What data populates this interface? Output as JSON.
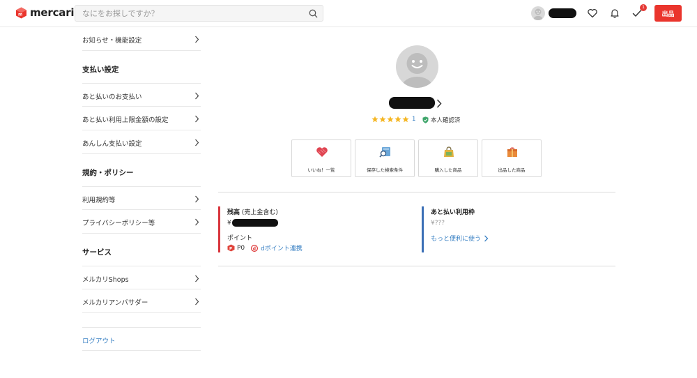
{
  "header": {
    "brand": "mercari",
    "search_placeholder": "なにをお探しですか？",
    "notification_badge": "1",
    "sell_label": "出品"
  },
  "sidebar": {
    "top_item": "お知らせ・機能設定",
    "sections": [
      {
        "title": "支払い設定",
        "items": [
          "あと払いのお支払い",
          "あと払い利用上限金額の設定",
          "あんしん支払い設定"
        ]
      },
      {
        "title": "規約・ポリシー",
        "items": [
          "利用規約等",
          "プライバシーポリシー等"
        ]
      },
      {
        "title": "サービス",
        "items": [
          "メルカリShops",
          "メルカリアンバサダー"
        ]
      }
    ],
    "logout": "ログアウト"
  },
  "profile": {
    "rating": 5,
    "rating_count": "1",
    "verified_label": "本人確認済"
  },
  "tiles": [
    {
      "label": "いいね！一覧",
      "icon": "heart-icon"
    },
    {
      "label": "保存した検索条件",
      "icon": "saved-search-icon"
    },
    {
      "label": "購入した商品",
      "icon": "purchase-bag-icon"
    },
    {
      "label": "出品した商品",
      "icon": "listed-box-icon"
    }
  ],
  "balance": {
    "title_bold": "残高",
    "title_rest": " (売上金含む)",
    "currency": "¥",
    "points_label": "ポイント",
    "points_value": "P0",
    "d_point_link": "dポイント連携"
  },
  "atobarai": {
    "title": "あと払い利用枠",
    "amount": "¥???",
    "link": "もっと便利に使う"
  },
  "colors": {
    "brand_red": "#ea352d",
    "link_blue": "#3b82c4",
    "accent_blue": "#3b6fb6",
    "star_yellow": "#f5b623"
  }
}
